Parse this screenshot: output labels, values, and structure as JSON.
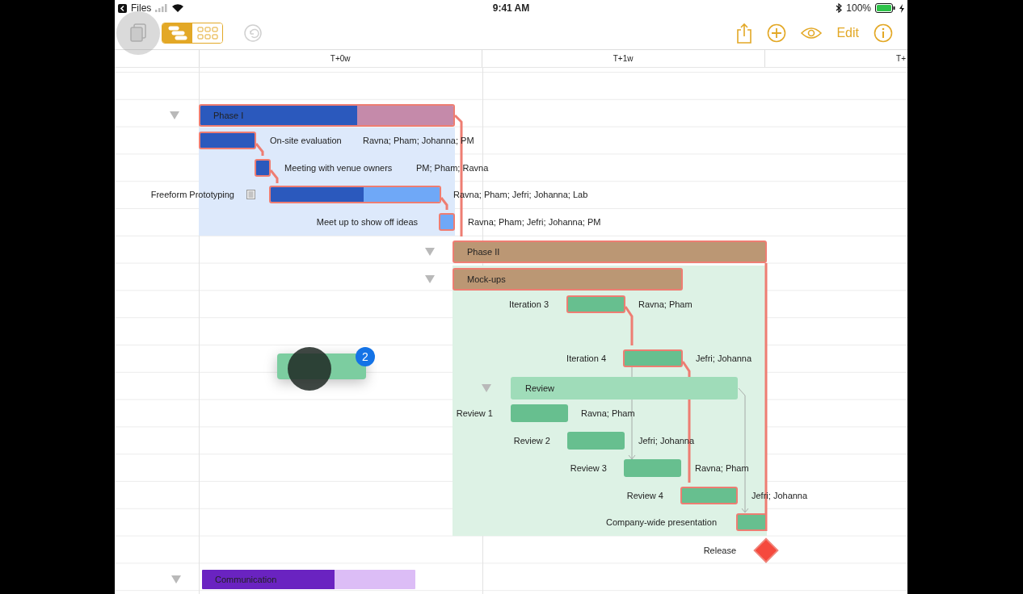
{
  "status_bar": {
    "back_label": "Files",
    "time": "9:41 AM",
    "battery": "100%"
  },
  "toolbar": {
    "view_modes": [
      {
        "selected": true
      },
      {
        "selected": false
      }
    ],
    "undo": {
      "disabled": true
    },
    "edit_label": "Edit"
  },
  "timeline": {
    "columns": [
      "T+0w",
      "T+1w",
      "T+"
    ]
  },
  "tasks": [
    {
      "kind": "group",
      "name": "Phase I",
      "expanded": true,
      "critical": true,
      "color": "#2b59bd",
      "remaining": {
        "color": "#c58aaa"
      },
      "level": 0.62,
      "children": [
        {
          "kind": "task",
          "name": "On-site evaluation",
          "assignees": "Ravna; Pham; Johanna; PM",
          "critical": true,
          "color": "#2b59bd"
        },
        {
          "kind": "task",
          "name": "Meeting with venue owners",
          "assignees": "PM; Pham; Ravna",
          "critical": true,
          "color": "#2b59bd"
        },
        {
          "kind": "task",
          "name": "Freeform Prototyping",
          "assignees": "Ravna; Pham; Jefri; Johanna; Lab",
          "critical": true,
          "has_note": true,
          "color": "#2b59bd",
          "remaining": {
            "color": "#6fa8f7"
          },
          "level": 0.55
        },
        {
          "kind": "task",
          "name": "Meet up to show off ideas",
          "assignees": "Ravna; Pham; Jefri; Johanna; PM",
          "critical": true,
          "color": "#6fa8f7"
        }
      ]
    },
    {
      "kind": "group",
      "name": "Phase II",
      "expanded": true,
      "critical": true,
      "color": "#bb9774",
      "children": [
        {
          "kind": "group",
          "name": "Mock-ups",
          "expanded": true,
          "critical": true,
          "color": "#bb9774",
          "children": [
            {
              "kind": "task",
              "name": "Iteration 3",
              "assignees": "Ravna; Pham",
              "critical": true,
              "color": "#67bf8f"
            },
            {
              "kind": "task",
              "name": "Iteration 4",
              "assignees": "Jefri; Johanna",
              "critical": true,
              "color": "#67bf8f"
            },
            {
              "kind": "group",
              "name": "Review",
              "expanded": true,
              "critical": false,
              "color": "#9fdcb9",
              "children": [
                {
                  "kind": "task",
                  "name": "Review 1",
                  "assignees": "Ravna; Pham",
                  "critical": false,
                  "color": "#67bf8f"
                },
                {
                  "kind": "task",
                  "name": "Review 2",
                  "assignees": "Jefri; Johanna",
                  "critical": false,
                  "color": "#67bf8f"
                },
                {
                  "kind": "task",
                  "name": "Review 3",
                  "assignees": "Ravna; Pham",
                  "critical": false,
                  "color": "#67bf8f"
                },
                {
                  "kind": "task",
                  "name": "Review 4",
                  "assignees": "Jefri; Johanna",
                  "critical": true,
                  "color": "#67bf8f"
                }
              ]
            }
          ]
        },
        {
          "kind": "task",
          "name": "Company-wide presentation",
          "critical": true,
          "color": "#67bf8f"
        }
      ]
    },
    {
      "kind": "milestone",
      "name": "Release",
      "critical": true,
      "color": "#f5493d"
    },
    {
      "kind": "group",
      "name": "Communication",
      "expanded": true,
      "critical": false,
      "color": "#6a23c1",
      "remaining": {
        "color": "#dcbdf6"
      },
      "level": 0.62
    }
  ],
  "drag": {
    "badge": "2"
  }
}
